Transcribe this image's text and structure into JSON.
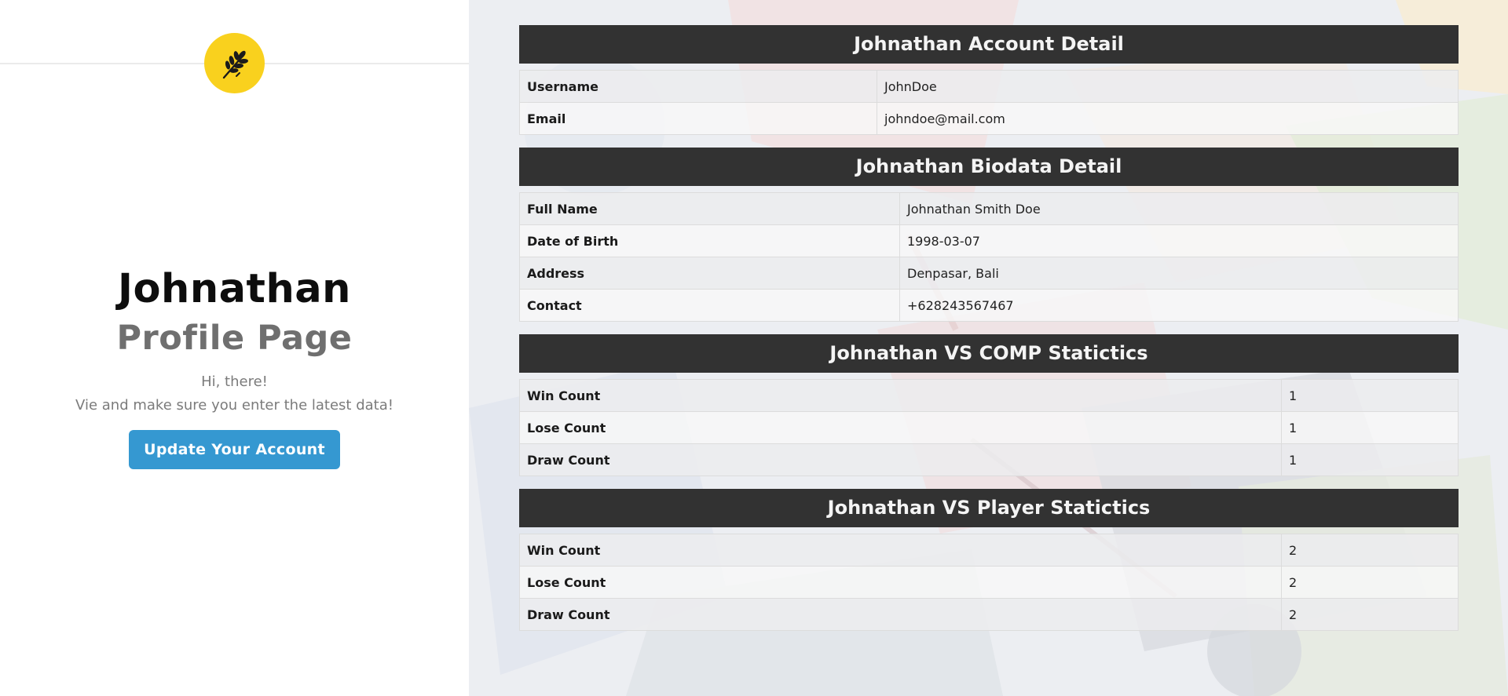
{
  "profile": {
    "name": "Johnathan",
    "subtitle": "Profile Page",
    "greeting_line1": "Hi, there!",
    "greeting_line2": "Vie and make sure you enter the latest data!",
    "update_button": "Update Your Account"
  },
  "colors": {
    "logo_bg": "#f9d11e",
    "button_bg": "#3598d1",
    "section_header_bg": "#323232"
  },
  "sections": {
    "account": {
      "title": "Johnathan Account Detail",
      "rows": [
        {
          "label": "Username",
          "value": "JohnDoe"
        },
        {
          "label": "Email",
          "value": "johndoe@mail.com"
        }
      ]
    },
    "biodata": {
      "title": "Johnathan Biodata Detail",
      "rows": [
        {
          "label": "Full Name",
          "value": "Johnathan Smith Doe"
        },
        {
          "label": "Date of Birth",
          "value": "1998-03-07"
        },
        {
          "label": "Address",
          "value": "Denpasar, Bali"
        },
        {
          "label": "Contact",
          "value": "+628243567467"
        }
      ]
    },
    "vs_comp": {
      "title": "Johnathan VS COMP Statictics",
      "rows": [
        {
          "label": "Win Count",
          "value": "1"
        },
        {
          "label": "Lose Count",
          "value": "1"
        },
        {
          "label": "Draw Count",
          "value": "1"
        }
      ]
    },
    "vs_player": {
      "title": "Johnathan VS Player Statictics",
      "rows": [
        {
          "label": "Win Count",
          "value": "2"
        },
        {
          "label": "Lose Count",
          "value": "2"
        },
        {
          "label": "Draw Count",
          "value": "2"
        }
      ]
    }
  },
  "icons": {
    "logo": "wheat-icon"
  }
}
